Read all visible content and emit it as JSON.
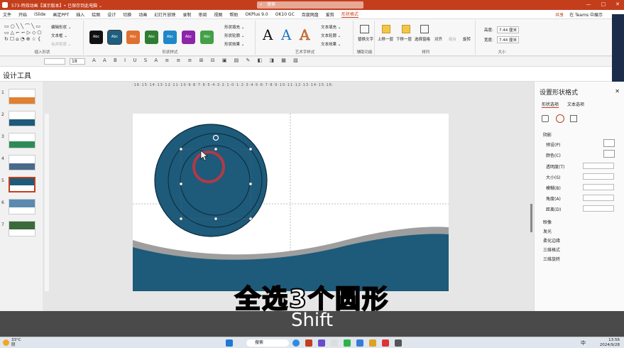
{
  "titlebar": {
    "doc": "573-特效动画【演示版本】• 已保存到此电脑 ⌄",
    "search": "搜索",
    "min": "—",
    "max": "□",
    "close": "✕"
  },
  "menu": {
    "items": [
      "文件",
      "开始",
      "iSlide",
      "画定PPT",
      "插入",
      "绘图",
      "设计",
      "切换",
      "动画",
      "幻灯片放映",
      "录制",
      "审阅",
      "视图",
      "帮助",
      "OKPlus 9.0",
      "OK10 GC",
      "百度网盘",
      "爱剪",
      "形状格式"
    ],
    "active": "形状格式",
    "share": "共享",
    "teams": "在 Teams 中展示"
  },
  "ribbon": {
    "insert_shapes": {
      "label": "插入形状",
      "edit_shape": "编辑形状 ⌄",
      "textbox": "文本框 ⌄",
      "merge": "合并形状 ⌄"
    },
    "shape_styles": {
      "label": "形状样式",
      "swatches": [
        {
          "t": "Abc",
          "c": "#111111"
        },
        {
          "t": "Abc",
          "c": "#1e5f80"
        },
        {
          "t": "Abc",
          "c": "#e07030"
        },
        {
          "t": "Abc",
          "c": "#2e7d32"
        },
        {
          "t": "Abc",
          "c": "#1e88c8"
        },
        {
          "t": "Abc",
          "c": "#8e24aa"
        },
        {
          "t": "Abc",
          "c": "#43a047"
        }
      ],
      "fill": "形状填充 ⌄",
      "outline": "形状轮廓 ⌄",
      "effect": "形状效果 ⌄"
    },
    "wordart": {
      "label": "艺术字样式",
      "glyph": "A",
      "text_fill": "文本填充 ⌄",
      "text_outline": "文本轮廓 ⌄",
      "text_effect": "文本效果 ⌄"
    },
    "accessibility": {
      "label": "辅助功能",
      "alt": "替换文字"
    },
    "arrange": {
      "label": "排列",
      "forward": "上移一层",
      "backward": "下移一层",
      "pane": "选择窗格",
      "align": "对齐",
      "group": "组合",
      "rotate": "旋转"
    },
    "size": {
      "label": "大小",
      "height_label": "高度:",
      "height": "7.44 厘米",
      "width_label": "宽度:",
      "width": "7.44 厘米"
    }
  },
  "toolbar2": {
    "font_size": "18"
  },
  "design_tools": "设计工具",
  "thumbnails": [
    "1",
    "2",
    "3",
    "4",
    "5",
    "6",
    "7"
  ],
  "ruler": "·16·15·14·13·12·11·10·9·8·7·6·5·4·3·2·1·0·1·2·3·4·5·6·7·8·9·10·11·12·13·14·15·16·",
  "panel": {
    "title": "设置形状格式",
    "tab1": "形状选项",
    "tab2": "文本选项",
    "section": "阴影",
    "preset": "预设(P)",
    "color": "颜色(C)",
    "transparency": "透明度(T)",
    "size": "大小(S)",
    "blur": "模糊(B)",
    "angle": "角度(A)",
    "distance": "距离(D)",
    "collapsed": [
      "映像",
      "发光",
      "柔化边缘",
      "三维格式",
      "三维旋转"
    ],
    "close": "✕"
  },
  "subtitle": {
    "line1": "全选3个圆形",
    "line2": "Shift"
  },
  "taskbar": {
    "weather_temp": "33°C",
    "weather_desc": "阴",
    "search": "搜索",
    "time": "13:56",
    "date": "2024/9/28",
    "lang": "中"
  },
  "colors": {
    "accent": "#c43e1c",
    "navy": "#1e5a7a",
    "ring": "#b03a48",
    "grey": "#9e9e9e"
  }
}
